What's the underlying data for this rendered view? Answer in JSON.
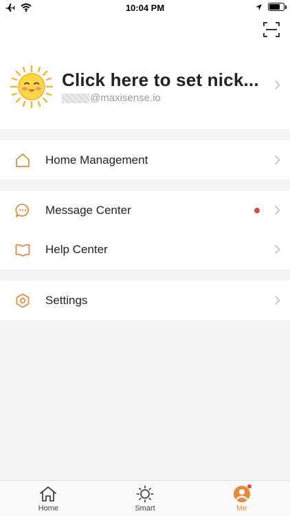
{
  "status_bar": {
    "time": "10:04 PM"
  },
  "profile": {
    "nickname": "Click here to set nick...",
    "email_suffix": "@maxisense.io"
  },
  "menu_groups": [
    [
      {
        "label": "Home Management",
        "icon": "house-icon"
      }
    ],
    [
      {
        "label": "Message Center",
        "icon": "chat-bubble-icon",
        "unread": true
      },
      {
        "label": "Help Center",
        "icon": "book-icon"
      }
    ],
    [
      {
        "label": "Settings",
        "icon": "hexagon-settings-icon"
      }
    ]
  ],
  "tabs": [
    {
      "label": "Home",
      "icon": "home-tab-icon",
      "active": false
    },
    {
      "label": "Smart",
      "icon": "sun-tab-icon",
      "active": false
    },
    {
      "label": "Me",
      "icon": "profile-tab-icon",
      "active": true,
      "badge": true
    }
  ],
  "colors": {
    "accent": "#e58a3c",
    "badge": "#e5483a",
    "background": "#f4f4f4"
  }
}
